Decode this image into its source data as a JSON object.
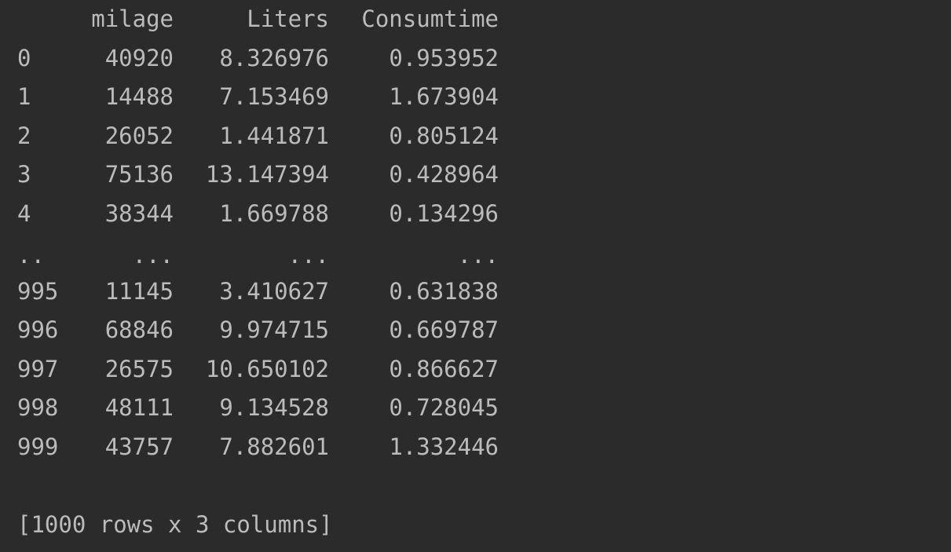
{
  "console": {
    "header": {
      "index": "",
      "milage": "milage",
      "liters": "Liters",
      "consumtime": "Consumtime"
    },
    "rows": [
      {
        "index": "0",
        "milage": "40920",
        "liters": "8.326976",
        "consumtime": "0.953952"
      },
      {
        "index": "1",
        "milage": "14488",
        "liters": "7.153469",
        "consumtime": "1.673904"
      },
      {
        "index": "2",
        "milage": "26052",
        "liters": "1.441871",
        "consumtime": "0.805124"
      },
      {
        "index": "3",
        "milage": "75136",
        "liters": "13.147394",
        "consumtime": "0.428964"
      },
      {
        "index": "4",
        "milage": "38344",
        "liters": "1.669788",
        "consumtime": "0.134296"
      },
      {
        "index": "..",
        "milage": "...",
        "liters": "...",
        "consumtime": "..."
      },
      {
        "index": "995",
        "milage": "11145",
        "liters": "3.410627",
        "consumtime": "0.631838"
      },
      {
        "index": "996",
        "milage": "68846",
        "liters": "9.974715",
        "consumtime": "0.669787"
      },
      {
        "index": "997",
        "milage": "26575",
        "liters": "10.650102",
        "consumtime": "0.866627"
      },
      {
        "index": "998",
        "milage": "48111",
        "liters": "9.134528",
        "consumtime": "0.728045"
      },
      {
        "index": "999",
        "milage": "43757",
        "liters": "7.882601",
        "consumtime": "1.332446"
      }
    ],
    "summary": "[1000 rows x 3 columns]",
    "colors": {
      "background": "#2b2b2b",
      "text": "#bbbbbb"
    }
  }
}
